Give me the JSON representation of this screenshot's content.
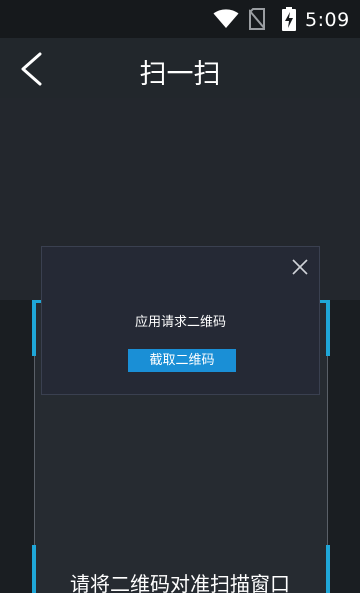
{
  "status_bar": {
    "time": "5:09",
    "icons": [
      "wifi-icon",
      "no-sim-icon",
      "battery-charging-icon"
    ]
  },
  "header": {
    "back_icon": "chevron-left-icon",
    "title": "扫一扫"
  },
  "scanner": {
    "hint": "请将二维码对准扫描窗口",
    "accent_color": "#1fa7d8"
  },
  "dialog": {
    "close_icon": "close-icon",
    "message": "应用请求二维码",
    "button_label": "截取二维码",
    "button_color": "#1a8fd6"
  }
}
